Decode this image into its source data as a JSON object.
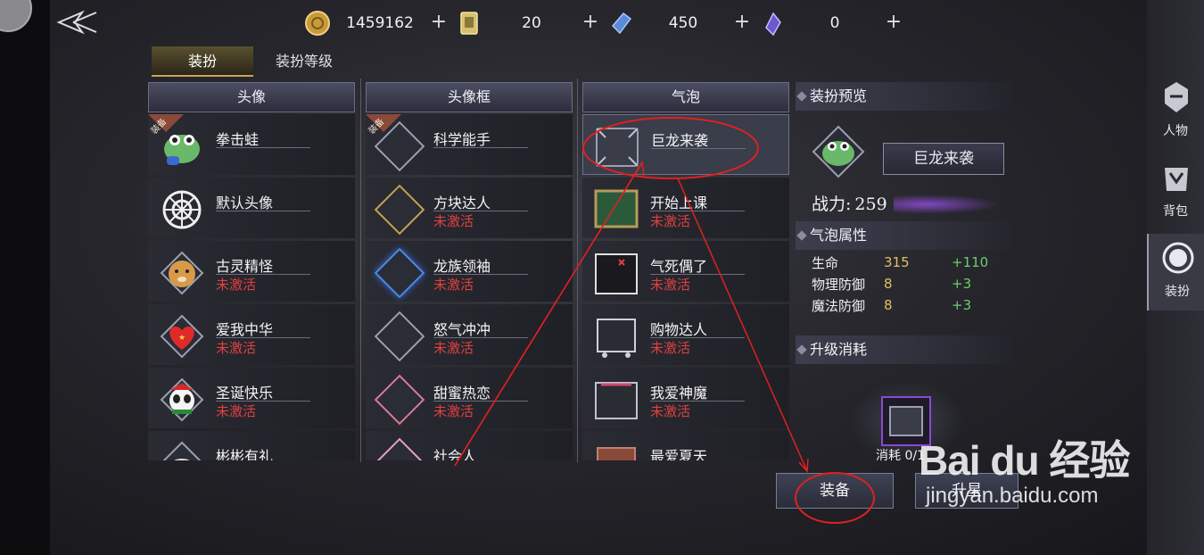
{
  "currency": [
    {
      "icon": "gold-coin-icon",
      "value": "1459162"
    },
    {
      "icon": "ticket-icon",
      "value": "20"
    },
    {
      "icon": "crystal-icon",
      "value": "450"
    },
    {
      "icon": "purple-gem-icon",
      "value": "0"
    }
  ],
  "tabs": [
    "装扮",
    "装扮等级"
  ],
  "columns": {
    "avatar": {
      "header": "头像",
      "items": [
        {
          "name": "拳击蛙",
          "status": "",
          "badge": "装备"
        },
        {
          "name": "默认头像",
          "status": ""
        },
        {
          "name": "古灵精怪",
          "status": "未激活"
        },
        {
          "name": "爱我中华",
          "status": "未激活"
        },
        {
          "name": "圣诞快乐",
          "status": "未激活"
        },
        {
          "name": "彬彬有礼",
          "status": ""
        }
      ]
    },
    "frame": {
      "header": "头像框",
      "items": [
        {
          "name": "科学能手",
          "status": "",
          "badge": "装备"
        },
        {
          "name": "方块达人",
          "status": "未激活"
        },
        {
          "name": "龙族领袖",
          "status": "未激活"
        },
        {
          "name": "怒气冲冲",
          "status": "未激活"
        },
        {
          "name": "甜蜜热恋",
          "status": "未激活"
        },
        {
          "name": "社会人",
          "status": ""
        }
      ]
    },
    "bubble": {
      "header": "气泡",
      "items": [
        {
          "name": "巨龙来袭",
          "status": ""
        },
        {
          "name": "开始上课",
          "status": "未激活"
        },
        {
          "name": "气死偶了",
          "status": "未激活"
        },
        {
          "name": "购物达人",
          "status": "未激活"
        },
        {
          "name": "我爱神魔",
          "status": "未激活"
        },
        {
          "name": "最爱夏天",
          "status": ""
        }
      ]
    }
  },
  "preview": {
    "title": "装扮预览",
    "name": "巨龙来袭",
    "power_label": "战力:",
    "power_value": "259",
    "attr_title": "气泡属性",
    "attrs": [
      {
        "name": "生命",
        "value": "315",
        "delta": "+110"
      },
      {
        "name": "物理防御",
        "value": "8",
        "delta": "+3"
      },
      {
        "name": "魔法防御",
        "value": "8",
        "delta": "+3"
      }
    ],
    "cost_title": "升级消耗",
    "cost_label": "消耗 0/1"
  },
  "buttons": {
    "equip": "装备",
    "upgrade": "升星"
  },
  "nav": [
    {
      "label": "人物",
      "icon": "helmet-icon"
    },
    {
      "label": "背包",
      "icon": "bag-icon"
    },
    {
      "label": "装扮",
      "icon": "costume-icon"
    }
  ],
  "watermark": {
    "logo": "Bai du 经验",
    "url": "jingyan.baidu.com"
  },
  "colors": {
    "inactive": "#e04040",
    "bonus": "#6ad06a",
    "stat": "#e0c060",
    "annotation": "#e02020"
  }
}
